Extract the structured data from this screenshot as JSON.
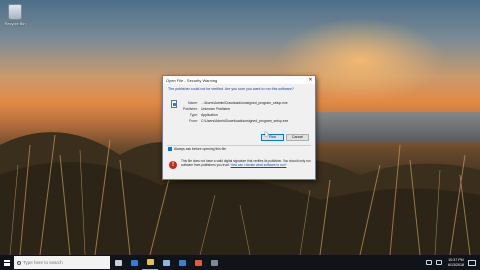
{
  "desktop": {
    "recycle_label": "Recycle Bin"
  },
  "dialog": {
    "title": "Open File - Security Warning",
    "close_glyph": "✕",
    "question": "The publisher could not be verified. Are you sure you want to run this software?",
    "fields": [
      {
        "label": "Name:",
        "value": "...\\Users\\Admin\\Downloads\\unsigned_program_setup.exe"
      },
      {
        "label": "Publisher:",
        "value": "Unknown Publisher"
      },
      {
        "label": "Type:",
        "value": "Application"
      },
      {
        "label": "From:",
        "value": "C:\\Users\\Admin\\Downloads\\unsigned_program_setup.exe"
      }
    ],
    "open_label": "Run",
    "cancel_label": "Cancel",
    "checkbox_label": "Always ask before opening this file",
    "checkbox_checked": true,
    "shield_glyph": "!",
    "warning_text": "This file does not have a valid digital signature that verifies its publisher. You should only run software from publishers you trust.",
    "warning_link": "How can I decide what software to run?"
  },
  "taskbar": {
    "search_placeholder": "Type here to search",
    "clock_time": "10:37 PM",
    "clock_date": "6/13/2018",
    "pinned": [
      {
        "name": "task-view",
        "color": "#c8ced4"
      },
      {
        "name": "edge",
        "color": "#2f7fd6"
      },
      {
        "name": "file-explorer",
        "color": "#e8c14a"
      },
      {
        "name": "store",
        "color": "#8fb5e0"
      },
      {
        "name": "mail",
        "color": "#3f7fd0"
      },
      {
        "name": "media",
        "color": "#e25b3a"
      },
      {
        "name": "app",
        "color": "#7a8a9a"
      }
    ]
  },
  "colors": {
    "accent": "#0078d7",
    "warning_red": "#c42b1c",
    "question_blue": "#1a3d8f"
  }
}
